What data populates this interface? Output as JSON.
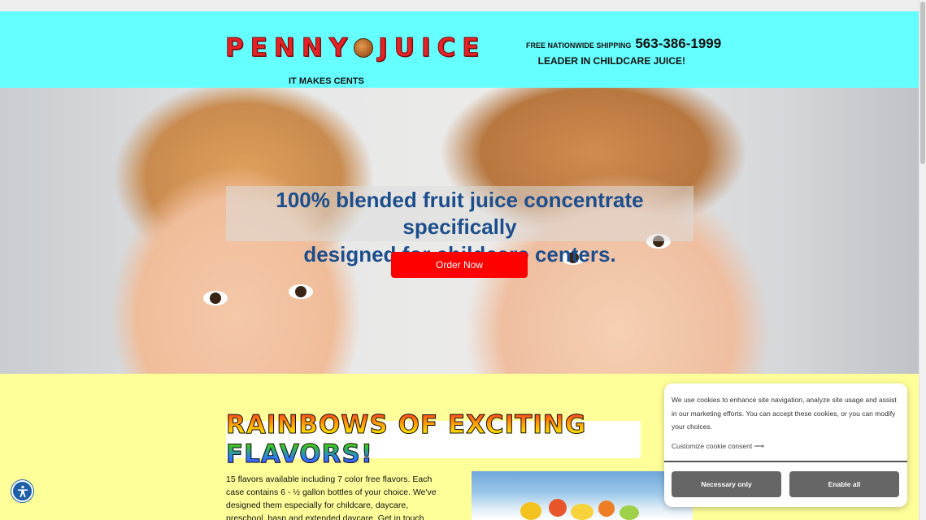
{
  "header": {
    "logo": {
      "text_left": "PENNY",
      "text_right": "JUICE",
      "coin_icon": "penny-coin-icon"
    },
    "tagline": "IT MAKES CENTS",
    "shipping_label": "FREE NATIONWIDE SHIPPING",
    "phone": "563-386-1999",
    "slogan": "LEADER IN CHILDCARE JUICE!"
  },
  "hero": {
    "headline_line1": "100% blended fruit juice concentrate specifically",
    "headline_line2": "designed for childcare centers.",
    "cta_label": "Order Now",
    "cta_color": "#ff0000",
    "headline_color": "#1d4e8c"
  },
  "flavors": {
    "banner": "RAINBOWS OF EXCITING FLAVORS!",
    "description": "15 flavors available including 7 color free flavors. Each case contains 6 - ½ gallon bottles of your choice. We've designed them especially for childcare, daycare, preschool, basp and extended daycare. Get in touch with us today!"
  },
  "accessibility": {
    "icon": "accessibility-icon"
  },
  "cookie_banner": {
    "message": "We use cookies to enhance site navigation, analyze site usage and assist in our marketing efforts. You can accept these cookies, or you can modify your choices.",
    "customize_label": "Customize cookie consent",
    "necessary_label": "Necessary only",
    "enable_all_label": "Enable all"
  },
  "colors": {
    "header_bg": "#66ffff",
    "body_bg": "#ffff99",
    "logo_red": "#e52226"
  }
}
